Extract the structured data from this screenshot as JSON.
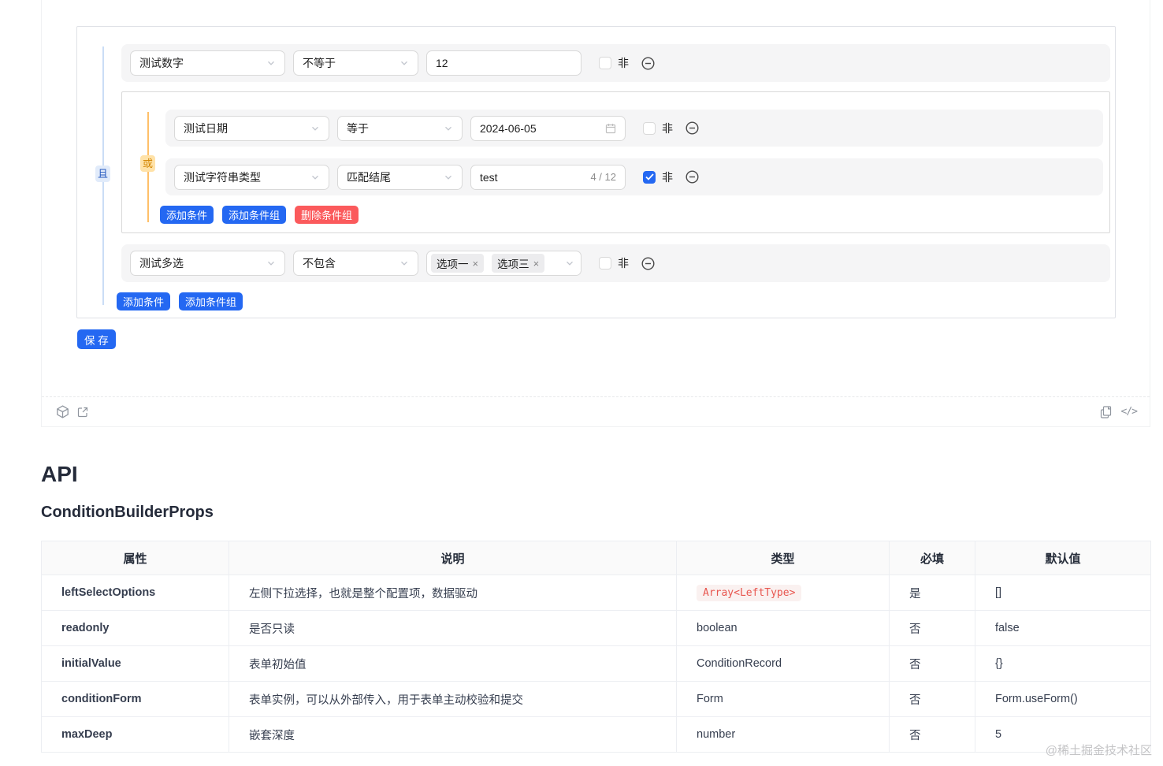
{
  "builder": {
    "root_logic": "且",
    "condition1": {
      "field": "测试数字",
      "operator": "不等于",
      "value": "12",
      "not_label": "非"
    },
    "group": {
      "logic": "或",
      "condition_date": {
        "field": "测试日期",
        "operator": "等于",
        "value": "2024-06-05",
        "not_label": "非"
      },
      "condition_string": {
        "field": "测试字符串类型",
        "operator": "匹配结尾",
        "value": "test",
        "counter": "4 / 12",
        "not_label": "非"
      },
      "add_condition_label": "添加条件",
      "add_group_label": "添加条件组",
      "delete_group_label": "删除条件组"
    },
    "condition_multi": {
      "field": "测试多选",
      "operator": "不包含",
      "tags": [
        "选项一",
        "选项三"
      ],
      "not_label": "非"
    },
    "add_condition_label": "添加条件",
    "add_group_label": "添加条件组",
    "save_label": "保 存"
  },
  "icons": {
    "close": "×",
    "code_glyph": "</>"
  },
  "colors": {
    "primary": "#2468f2",
    "danger": "#fb5a5c",
    "and_badge_bg": "#e1ebfa",
    "and_badge_text": "#2257bf",
    "or_badge_bg": "#ffe2a8",
    "or_badge_text": "#d48806",
    "row_bg": "#f5f5f6",
    "type_code_text": "#e8564f"
  },
  "api": {
    "heading": "API",
    "subheading": "ConditionBuilderProps",
    "table": {
      "headers": [
        "属性",
        "说明",
        "类型",
        "必填",
        "默认值"
      ],
      "rows": [
        {
          "prop": "leftSelectOptions",
          "desc": "左侧下拉选择，也就是整个配置项，数据驱动",
          "type": "Array<LeftType>",
          "required": "是",
          "default": "[]"
        },
        {
          "prop": "readonly",
          "desc": "是否只读",
          "type": "boolean",
          "required": "否",
          "default": "false"
        },
        {
          "prop": "initialValue",
          "desc": "表单初始值",
          "type": "ConditionRecord",
          "required": "否",
          "default": "{}"
        },
        {
          "prop": "conditionForm",
          "desc": "表单实例，可以从外部传入，用于表单主动校验和提交",
          "type": "Form",
          "required": "否",
          "default": "Form.useForm()"
        },
        {
          "prop": "maxDeep",
          "desc": "嵌套深度",
          "type": "number",
          "required": "否",
          "default": "5"
        }
      ]
    }
  },
  "watermark": "@稀土掘金技术社区"
}
